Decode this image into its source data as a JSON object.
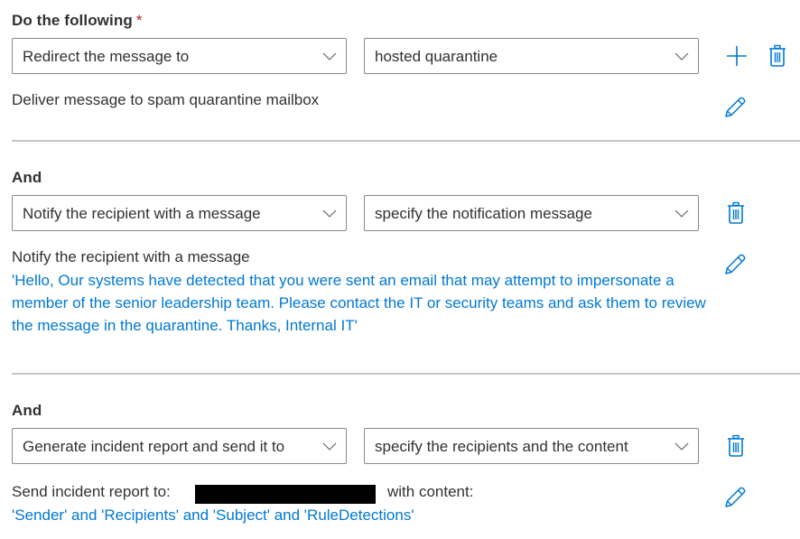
{
  "header": {
    "label": "Do the following",
    "required_marker": "*"
  },
  "actions": [
    {
      "connector": "Do the following",
      "action_select": "Redirect the message to",
      "target_select": "hosted quarantine",
      "summary": "Deliver message to spam quarantine mailbox",
      "buttons": [
        "add",
        "delete",
        "edit"
      ]
    },
    {
      "connector": "And",
      "action_select": "Notify the recipient with a message",
      "target_select": "specify the notification message",
      "summary": "Notify the recipient with a message",
      "detail": "'Hello, Our systems have detected that you were sent an email that may attempt to impersonate a member of the senior leadership team. Please contact the IT or security teams and ask them to review the message in the quarantine. Thanks, Internal IT'",
      "buttons": [
        "delete",
        "edit"
      ]
    },
    {
      "connector": "And",
      "action_select": "Generate incident report and send it to",
      "target_select": "specify the recipients and the content",
      "summary_prefix": "Send incident report to:",
      "summary_recipient": "[redacted]",
      "summary_suffix": "with content:",
      "detail": "'Sender' and 'Recipients' and 'Subject' and 'RuleDetections'",
      "buttons": [
        "delete",
        "edit"
      ]
    }
  ],
  "icons": {
    "add": "plus-icon",
    "delete": "trash-icon",
    "edit": "pencil-icon",
    "dropdown": "chevron-down-icon"
  },
  "colors": {
    "accent": "#0078d4",
    "text": "#323130",
    "required": "#a4262c",
    "border": "#8a8886",
    "divider": "#c8c6c4"
  }
}
